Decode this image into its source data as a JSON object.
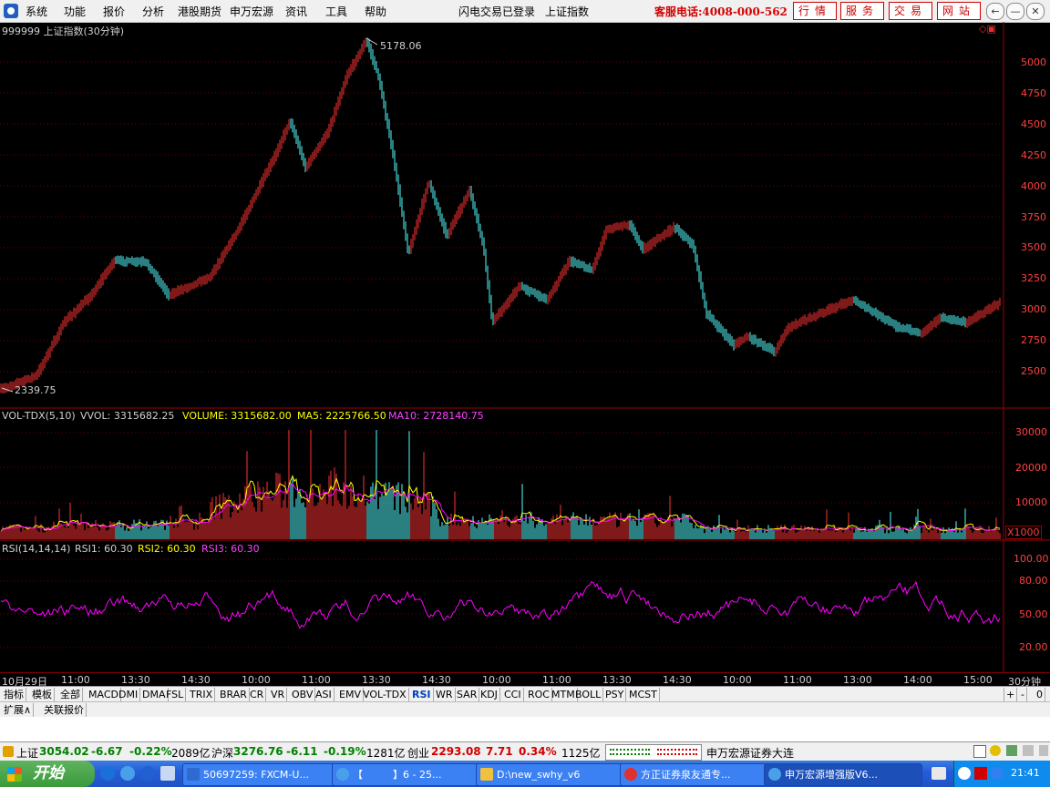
{
  "menu": {
    "items": [
      "系统",
      "功能",
      "报价",
      "分析",
      "港股期货",
      "申万宏源",
      "资讯",
      "工具",
      "帮助"
    ],
    "status_text": "闪电交易已登录",
    "index_name": "上证指数",
    "service_phone": "客服电话:4008-000-562",
    "right_buttons": [
      "行情",
      "服务",
      "交易",
      "网站"
    ],
    "window_buttons": [
      "←",
      "—",
      "✕"
    ]
  },
  "chart_title": "999999 上证指数(30分钟)",
  "price_panel": {
    "y_ticks": [
      "5000",
      "4750",
      "4500",
      "4250",
      "4000",
      "3750",
      "3500",
      "3250",
      "3000",
      "2750",
      "2500"
    ],
    "high_label": "5178.06",
    "low_label": "2339.75",
    "colors": {
      "up": "#ff3232",
      "down": "#54ffff"
    }
  },
  "volume_panel": {
    "legend": {
      "name": "VOL-TDX(5,10)",
      "vvol": "VVOL: 3315682.25",
      "volume": "VOLUME: 3315682.00",
      "ma5": "MA5: 2225766.50",
      "ma10": "MA10: 2728140.75"
    },
    "y_ticks": [
      "30000",
      "20000",
      "10000"
    ],
    "unit": "X1000"
  },
  "rsi_panel": {
    "legend": {
      "name": "RSI(14,14,14)",
      "rsi1": "RSI1: 60.30",
      "rsi2": "RSI2: 60.30",
      "rsi3": "RSI3: 60.30"
    },
    "y_ticks": [
      "100.00",
      "80.00",
      "50.00",
      "20.00"
    ],
    "line_color": "#ff00ff"
  },
  "time_axis": {
    "labels": [
      "10月29日",
      "11:00",
      "13:30",
      "14:30",
      "10:00",
      "11:00",
      "13:30",
      "14:30",
      "10:00",
      "11:00",
      "13:30",
      "14:30",
      "10:00",
      "11:00",
      "13:00",
      "14:00",
      "15:00"
    ],
    "period": "30分钟",
    "scroll_buttons": [
      "+",
      "-",
      "0"
    ]
  },
  "indicator_tabs": [
    "指标",
    "模板",
    "全部",
    "MACD",
    "DMI",
    "DMA",
    "FSL",
    "TRIX",
    "BRAR",
    "CR",
    "VR",
    "OBV",
    "ASI",
    "EMV",
    "VOL-TDX",
    "RSI",
    "WR",
    "SAR",
    "KDJ",
    "CCI",
    "ROC",
    "MTM",
    "BOLL",
    "PSY",
    "MCST"
  ],
  "active_tab": "RSI",
  "sub_tabs": [
    "扩展∧",
    "关联报价"
  ],
  "status_bar": {
    "sh": {
      "name": "上证",
      "price": "3054.02",
      "change": "-6.67",
      "pct": "-0.22%",
      "amount": "2089亿"
    },
    "hs": {
      "name": "沪深",
      "price": "3276.76",
      "change": "-6.11",
      "pct": "-0.19%",
      "amount": "1281亿"
    },
    "cy": {
      "name": "创业",
      "price": "2293.08",
      "change": "7.71",
      "pct": "0.34%",
      "amount": "1125亿"
    },
    "broker": "申万宏源证券大连"
  },
  "taskbar": {
    "start_label": "开始",
    "tasks": [
      "50697259: FXCM-U...",
      "【　　　】6 - 25...",
      "D:\\new_swhy_v6",
      "方正证券泉友通专...",
      "申万宏源增强版V6..."
    ],
    "clock": "21:41"
  }
}
